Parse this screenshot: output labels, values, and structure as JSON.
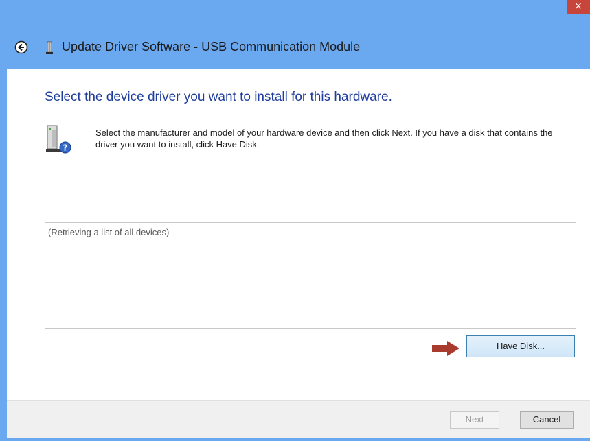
{
  "window": {
    "title": "Update Driver Software - USB Communication Module",
    "close_label": "×",
    "back_icon": "back-arrow-icon",
    "title_icon": "usb-device-icon"
  },
  "content": {
    "heading": "Select the device driver you want to install for this hardware.",
    "instructions": "Select the manufacturer and model of your hardware device and then click Next. If you have a disk that contains the driver you want to install, click Have Disk.",
    "hardware_icon": "hardware-question-icon",
    "device_list": {
      "status": "(Retrieving a list of all devices)"
    },
    "arrow_icon": "red-arrow-icon",
    "have_disk_label": "Have Disk..."
  },
  "footer": {
    "next_label": "Next",
    "cancel_label": "Cancel"
  },
  "colors": {
    "frame": "#6aa8f0",
    "heading": "#1e3c9c",
    "close": "#c7453a",
    "arrow": "#a83a2e"
  }
}
